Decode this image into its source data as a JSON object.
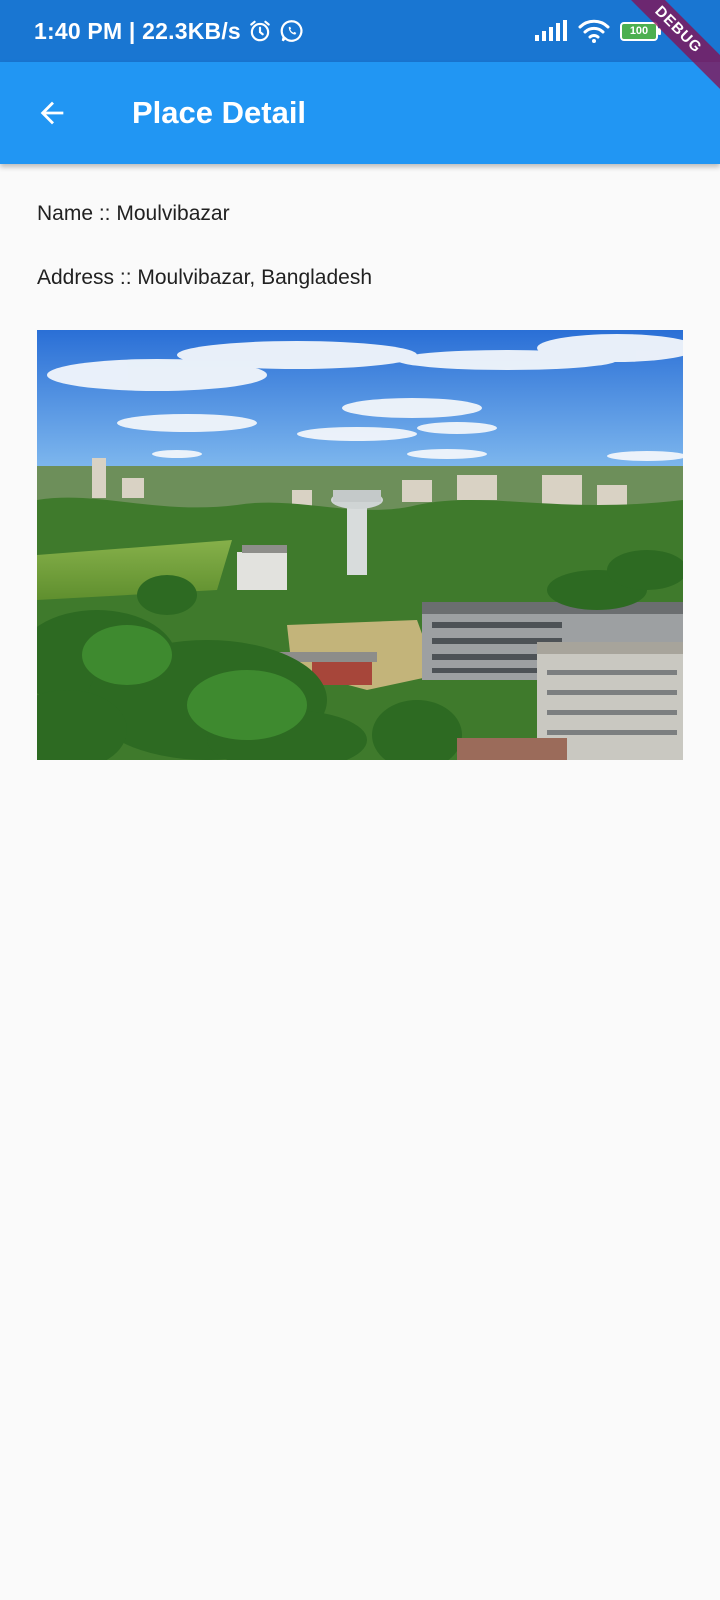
{
  "status_bar": {
    "time_speed": "1:40 PM | 22.3KB/s",
    "battery_level": "100",
    "icons": [
      "alarm-icon",
      "whatsapp-icon",
      "signal-icon",
      "wifi-icon",
      "battery-icon"
    ]
  },
  "debug_banner": "DEBUG",
  "app_bar": {
    "title": "Place Detail",
    "back_icon": "arrow-back-icon",
    "color": "#2196f3"
  },
  "place": {
    "name_line": "Name :: Moulvibazar",
    "address_line": "Address :: Moulvibazar, Bangladesh",
    "photo_subject": "aerial view of town with water tower, trees and buildings"
  }
}
